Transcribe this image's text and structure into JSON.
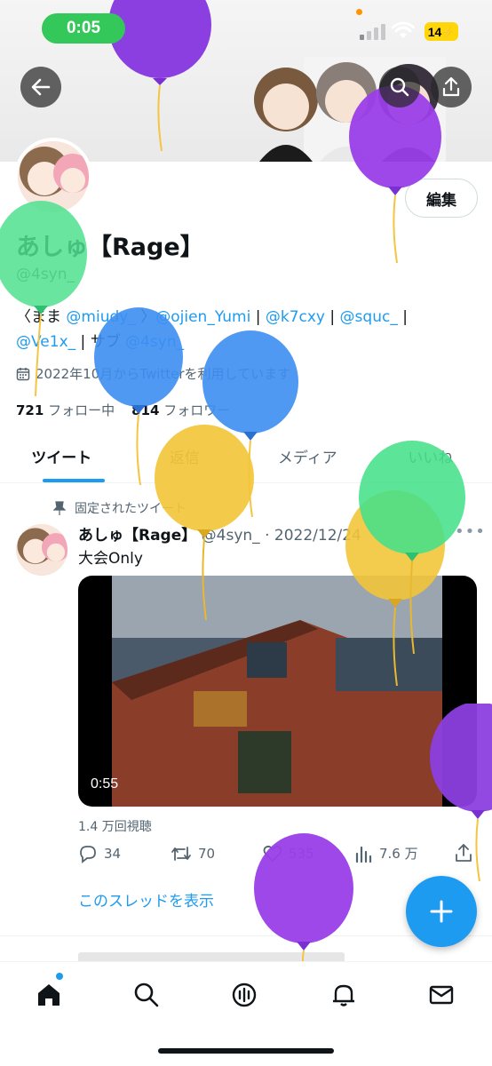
{
  "status_bar": {
    "time": "0:05",
    "battery": "14"
  },
  "colors": {
    "accent": "#1d9bf0",
    "status_time_pill": "#34c759",
    "battery": "#ffd60a",
    "balloon_purple": "#8a2be2",
    "balloon_blue": "#3a8ef0",
    "balloon_yellow": "#f5c518",
    "balloon_green": "#3ddc84"
  },
  "header": {
    "back_icon": "arrow-left-icon",
    "search_icon": "search-icon",
    "share_icon": "share-icon"
  },
  "profile": {
    "edit_label": "編集",
    "display_name": "あしゅ【Rage】",
    "handle": "@4syn_",
    "bio": {
      "prefix": "〈まま ",
      "m1": "@miudy_",
      "sep1": " 〉",
      "m2": "@ojien_Yumi",
      "sep2": " | ",
      "m3": "@k7cxy",
      "sep3": " | ",
      "m4": "@squc_",
      "sep4": " |",
      "m5": "@Ve1x_",
      "sep5": " | サブ ",
      "m6": "@4syn_"
    },
    "joined": "2022年10月からTwitterを利用しています",
    "following_count": "721",
    "following_label": " フォロー中",
    "followers_count": "814",
    "followers_label": " フォロワー"
  },
  "tabs": [
    "ツイート",
    "返信",
    "メディア",
    "いいね"
  ],
  "tweet": {
    "pinned_label": "固定されたツイート",
    "name": "あしゅ【Rage】",
    "meta": " @4syn_ · 2022/12/24",
    "text": "大会Only",
    "video_duration": "0:55",
    "views": "1.4 万回視聴",
    "replies": "34",
    "retweets": "70",
    "likes": "535",
    "impressions": "7.6 万",
    "thread_link": "このスレッドを表示"
  },
  "bottom_nav": [
    "home-icon",
    "search-icon",
    "spaces-icon",
    "bell-icon",
    "mail-icon"
  ]
}
